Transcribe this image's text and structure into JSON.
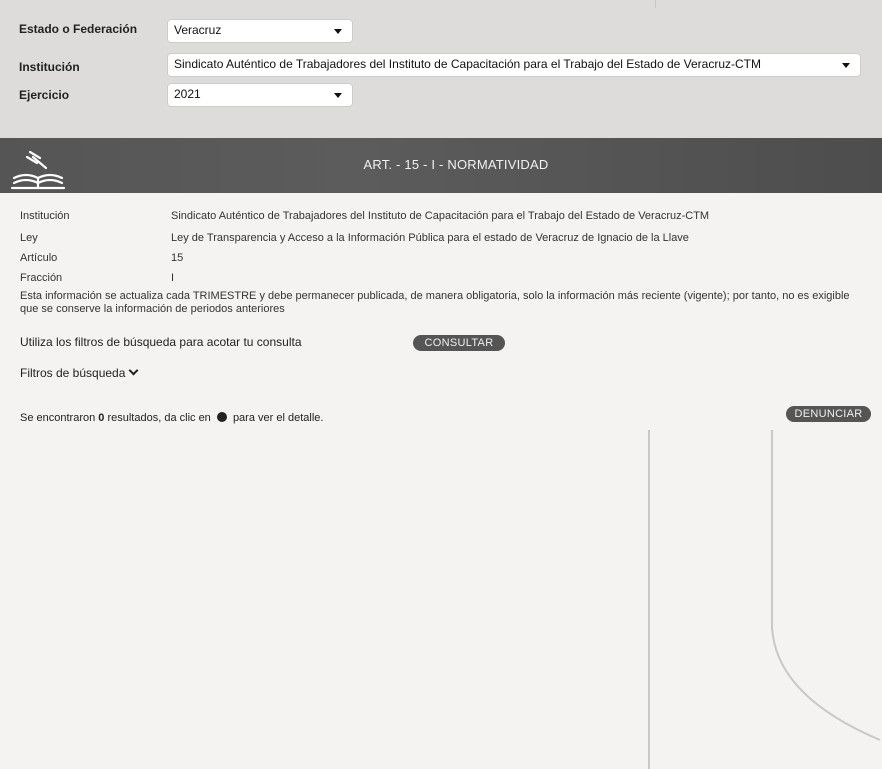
{
  "filters": {
    "state": {
      "label": "Estado o Federación",
      "value": "Veracruz"
    },
    "institution": {
      "label": "Institución",
      "value": "Sindicato Auténtico de Trabajadores del Instituto de Capacitación para el Trabajo del Estado de Veracruz-CTM"
    },
    "year": {
      "label": "Ejercicio",
      "value": "2021"
    }
  },
  "banner": {
    "title": "ART. - 15 - I - NORMATIVIDAD",
    "icon": "gavel-book-icon"
  },
  "details": {
    "institution_label": "Institución",
    "institution_value": "Sindicato Auténtico de Trabajadores del Instituto de Capacitación para el Trabajo del Estado de Veracruz-CTM",
    "law_label": "Ley",
    "law_value": "Ley de Transparencia y Acceso a la Información Pública para el estado de Veracruz de Ignacio de la Llave",
    "article_label": "Artículo",
    "article_value": "15",
    "fraction_label": "Fracción",
    "fraction_value": "I"
  },
  "notice": "Esta información se actualiza cada TRIMESTRE y debe permanecer publicada, de manera obligatoria, solo la información más reciente (vigente); por tanto, no es exigible que se conserve la información de periodos anteriores",
  "hint": "Utiliza los filtros de búsqueda para acotar tu consulta",
  "buttons": {
    "consult": "CONSULTAR",
    "report": "DENUNCIAR"
  },
  "filters_toggle": "Filtros de búsqueda",
  "results": {
    "prefix": "Se encontraron",
    "count": "0",
    "middle": "resultados, da clic en",
    "suffix": "para ver el detalle."
  },
  "colors": {
    "panel": "#dddcda",
    "banner": "#555555",
    "button": "#555555"
  }
}
